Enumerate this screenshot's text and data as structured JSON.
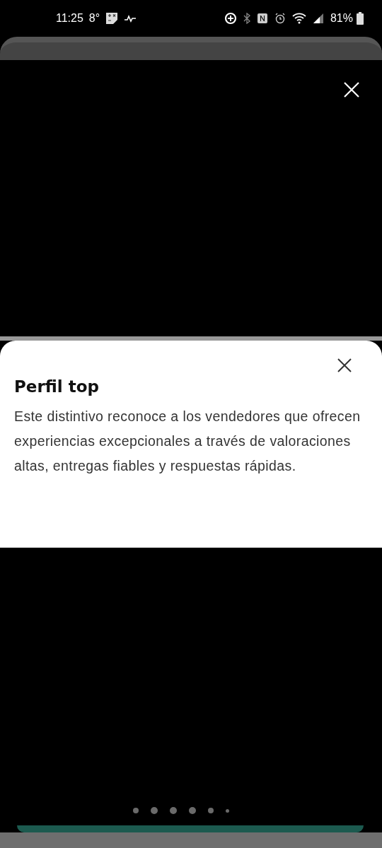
{
  "status_bar": {
    "time": "11:25",
    "temperature": "8°",
    "battery": "81%"
  },
  "sheet": {
    "title": "Perfil top",
    "body": "Este distintivo reconoce a los vendedores que ofrecen experiencias excepcionales a través de valoraciones altas, entregas fiables y respuestas rápidas."
  },
  "pager": [
    {
      "kind": "medium"
    },
    {
      "kind": "large"
    },
    {
      "kind": "large"
    },
    {
      "kind": "large"
    },
    {
      "kind": "medium"
    },
    {
      "kind": "small"
    }
  ]
}
